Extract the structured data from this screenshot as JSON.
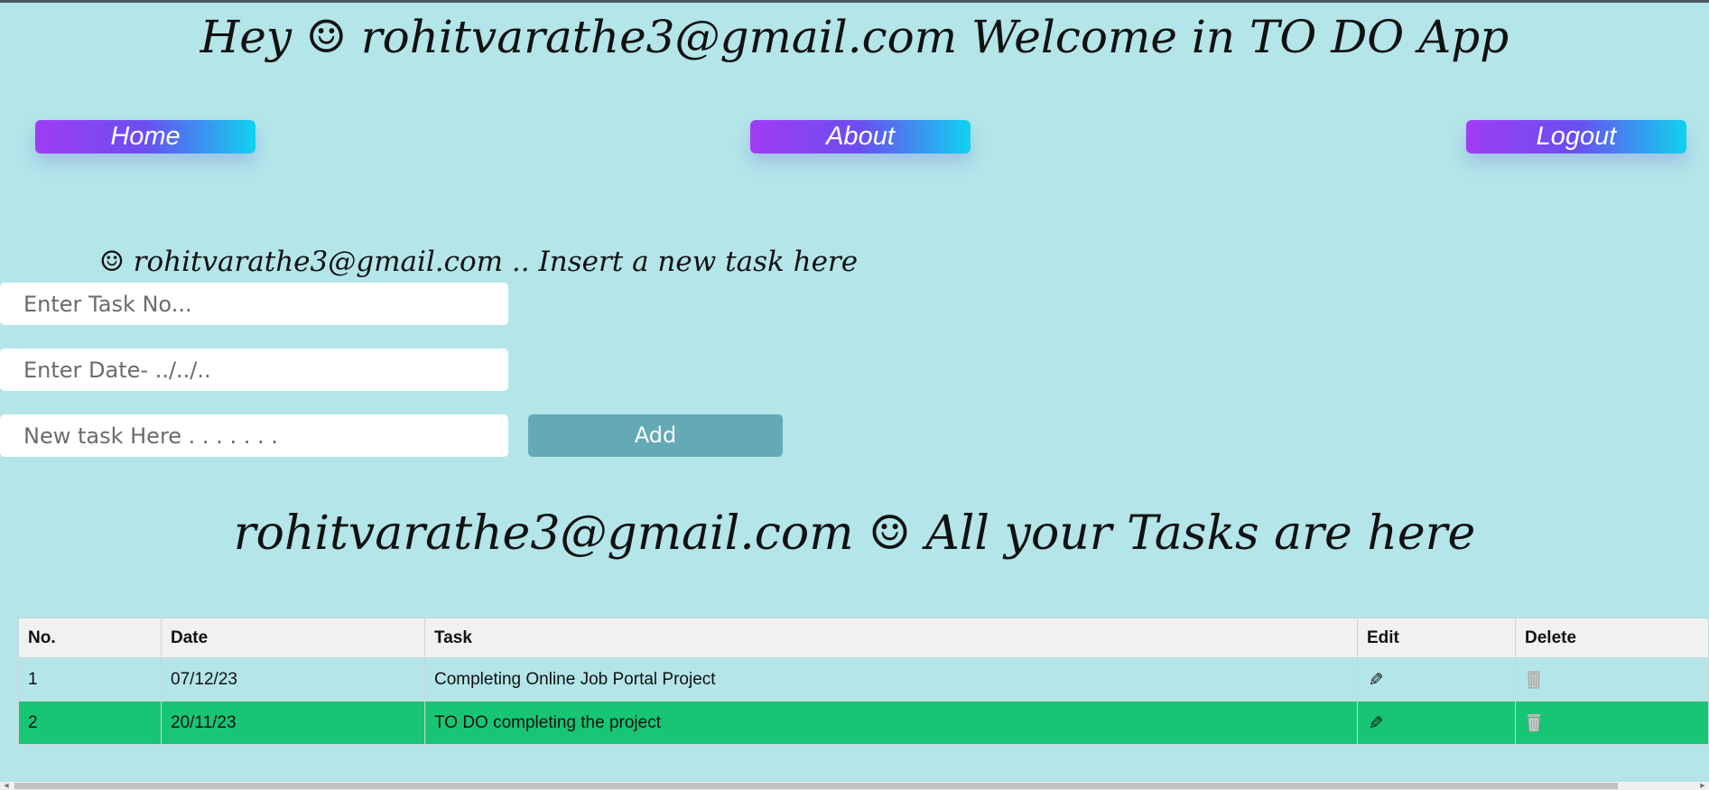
{
  "header": {
    "welcome": "Hey ☺ rohitvarathe3@gmail.com Welcome in TO DO App"
  },
  "nav": {
    "home": "Home",
    "about": "About",
    "logout": "Logout"
  },
  "form": {
    "heading": "☺ rohitvarathe3@gmail.com .. Insert a new task here",
    "task_no_placeholder": "Enter Task No...",
    "date_placeholder": "Enter Date- ../../..",
    "task_placeholder": "New task Here . . . . . . .",
    "add_label": "Add"
  },
  "tasks": {
    "heading": "rohitvarathe3@gmail.com ☺ All your Tasks are here",
    "columns": [
      "No.",
      "Date",
      "Task",
      "Edit",
      "Delete"
    ],
    "rows": [
      {
        "no": "1",
        "date": "07/12/23",
        "task": "Completing Online Job Portal Project",
        "edit_icon": "pencil-icon",
        "delete_icon": "trash-icon"
      },
      {
        "no": "2",
        "date": "20/11/23",
        "task": "TO DO completing the project",
        "edit_icon": "pencil-icon",
        "delete_icon": "trash-icon",
        "highlight_color": "#18c574"
      }
    ]
  },
  "colors": {
    "background": "#b3e5e9",
    "nav_gradient_start": "#a03cf5",
    "nav_gradient_end": "#0fd2ef",
    "add_button": "#63aab4",
    "highlight_row": "#18c574"
  }
}
